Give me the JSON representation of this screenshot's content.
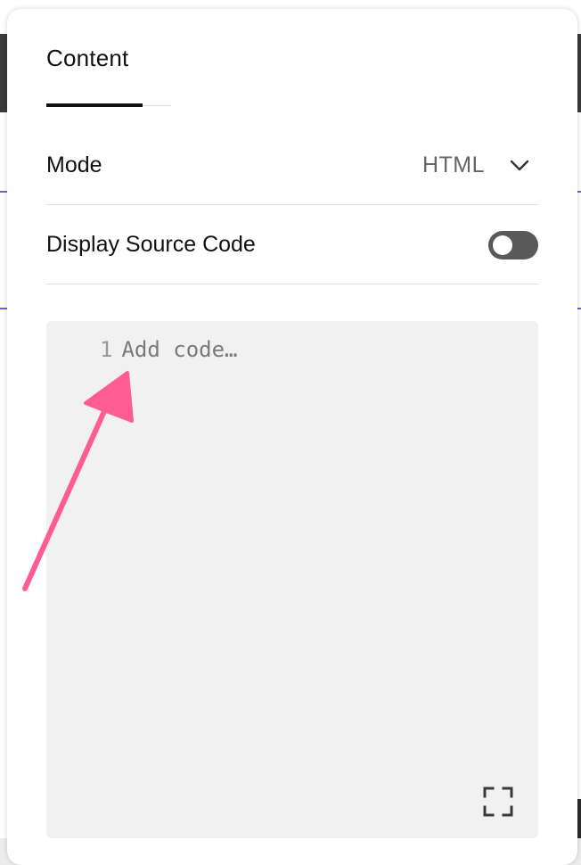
{
  "tabs": [
    {
      "label": "Content",
      "active": true
    }
  ],
  "mode": {
    "label": "Mode",
    "value": "HTML"
  },
  "display_source": {
    "label": "Display Source Code",
    "enabled": false
  },
  "code_editor": {
    "line_number": "1",
    "placeholder": "Add code…"
  },
  "icons": {
    "mode_dropdown": "chevron-down-icon",
    "editor_expand": "expand-icon"
  },
  "colors": {
    "annotation_arrow": "#ff5c93",
    "toggle_off": "#595959",
    "editor_bg": "#f1f1f1"
  }
}
